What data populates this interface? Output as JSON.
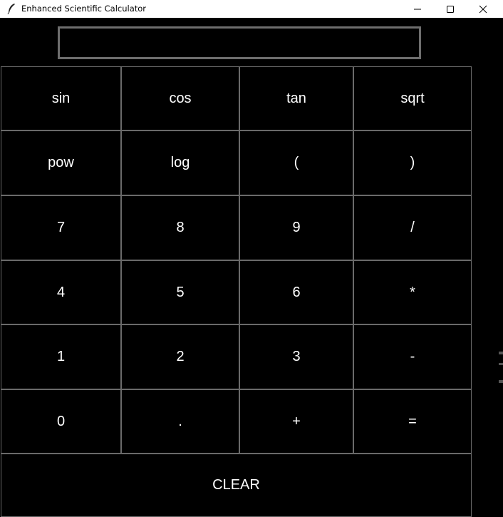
{
  "window": {
    "title": "Enhanced Scientific Calculator",
    "icons": {
      "app": "feather-icon",
      "minimize": "minimize-icon",
      "maximize": "maximize-icon",
      "close": "close-icon"
    }
  },
  "display": {
    "value": ""
  },
  "buttons": {
    "sin": "sin",
    "cos": "cos",
    "tan": "tan",
    "sqrt": "sqrt",
    "pow": "pow",
    "log": "log",
    "lparen": "(",
    "rparen": ")",
    "seven": "7",
    "eight": "8",
    "nine": "9",
    "divide": "/",
    "four": "4",
    "five": "5",
    "six": "6",
    "multiply": "*",
    "one": "1",
    "two": "2",
    "three": "3",
    "minus": "-",
    "zero": "0",
    "dot": ".",
    "plus": "+",
    "equals": "=",
    "clear": "CLEAR"
  },
  "colors": {
    "background": "#000000",
    "button_text": "#ffffff",
    "button_border": "#6a6a6a",
    "titlebar": "#ffffff"
  }
}
